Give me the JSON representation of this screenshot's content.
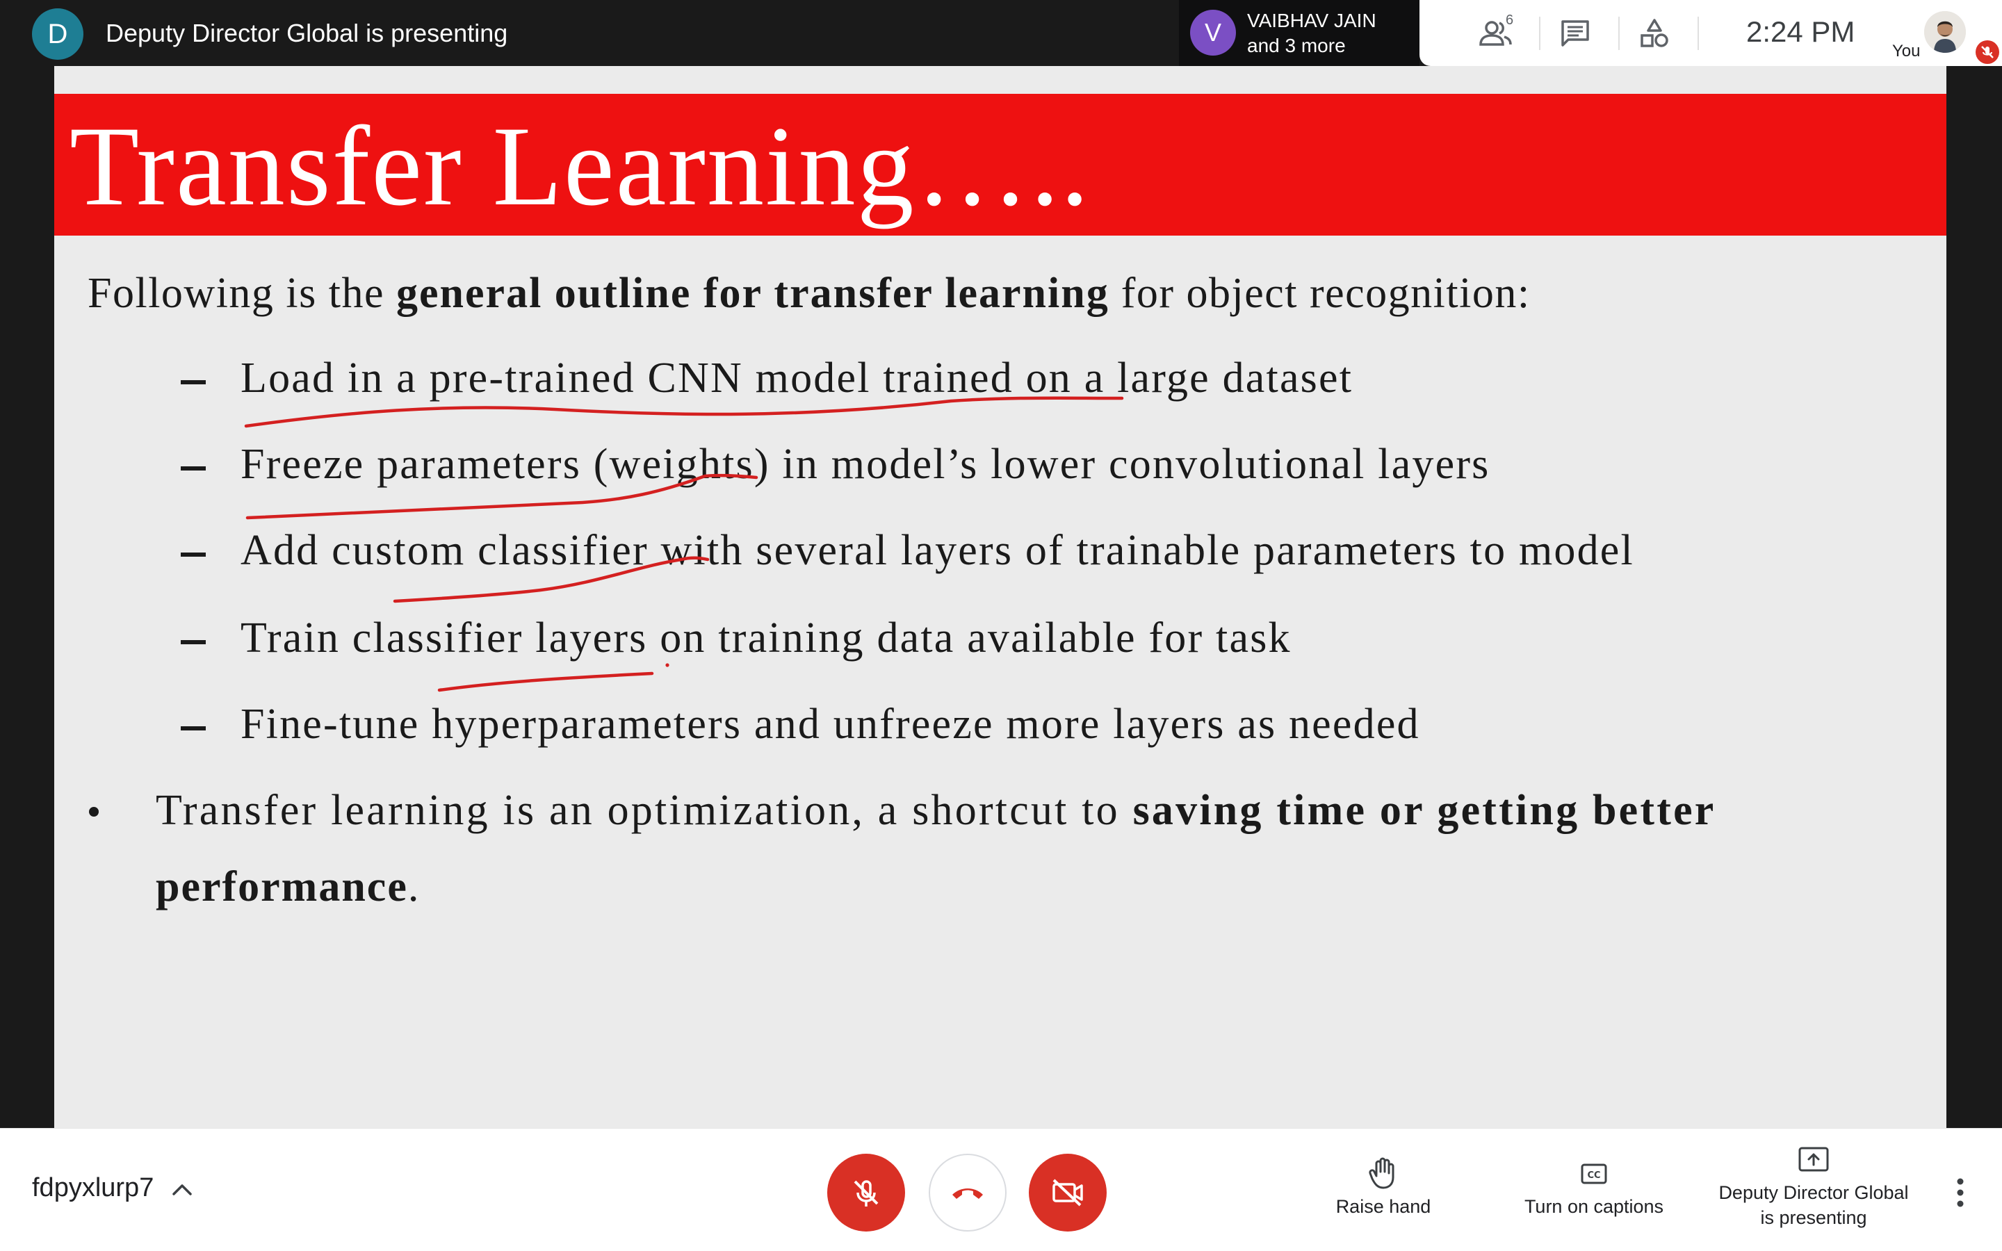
{
  "topbar": {
    "presenter_initial": "D",
    "presenter_text": "Deputy Director Global is presenting",
    "participants": {
      "initial": "V",
      "name": "VAIBHAV JAIN",
      "more": "and 3 more"
    },
    "people_count": "6",
    "clock": "2:24 PM",
    "self_label": "You",
    "icons": [
      "people-icon",
      "chat-icon",
      "activities-icon",
      "mic-off-icon"
    ]
  },
  "slide": {
    "title": "Transfer Learning…..",
    "intro": {
      "pre": "Following is the ",
      "bold": "general outline for transfer learning",
      "post": " for object recognition:"
    },
    "sub_items": [
      "Load in a pre-trained CNN model trained on a large dataset",
      "Freeze parameters (weights) in model’s lower convolutional layers",
      "Add custom classifier with several layers of trainable parameters to model",
      "Train classifier layers on training data available for task",
      "Fine-tune hyperparameters and unfreeze more layers as needed"
    ],
    "main_bullet": {
      "line1_pre": "Transfer learning is an optimization, a shortcut to ",
      "line1_bold": "saving time or getting better",
      "line2_bold": "performance",
      "line2_post": "."
    },
    "colors": {
      "header": "#ee1111",
      "annotation_ink": "#d42020",
      "background": "#ebebeb"
    }
  },
  "bottombar": {
    "meeting_code": "fdpyxlurp7",
    "controls": {
      "mic": "mic-off-icon",
      "end": "end-call-icon",
      "camera": "camera-off-icon",
      "danger_color": "#d93025"
    },
    "actions": {
      "raise_hand": "Raise hand",
      "captions": "Turn on captions",
      "presenting_line1": "Deputy Director Global",
      "presenting_line2": "is presenting"
    }
  }
}
